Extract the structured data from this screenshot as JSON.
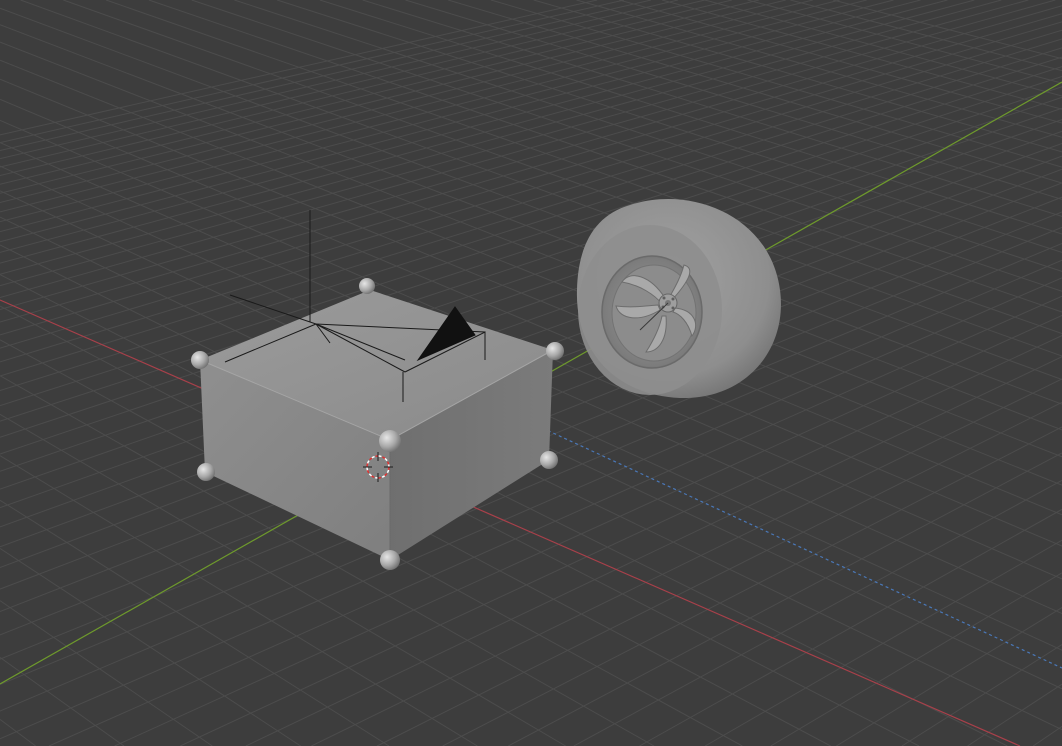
{
  "viewport": {
    "background": "#3d3d3d",
    "grid_color": "#4c4c4c",
    "x_axis_color": "#a8404a",
    "y_axis_color": "#6e9a2c",
    "z_axis_color": "#4a78b8"
  },
  "objects": [
    {
      "name": "cube",
      "kind": "mesh",
      "shading": "solid-gray",
      "vertex_handles": 8
    },
    {
      "name": "wheel",
      "kind": "mesh",
      "shading": "solid-gray"
    },
    {
      "name": "camera",
      "kind": "camera"
    },
    {
      "name": "light",
      "kind": "light"
    },
    {
      "name": "3d-cursor",
      "kind": "cursor"
    }
  ],
  "icons": {
    "cursor": "crosshair-target-icon",
    "light": "light-star-icon",
    "camera": "camera-frustum-icon"
  }
}
